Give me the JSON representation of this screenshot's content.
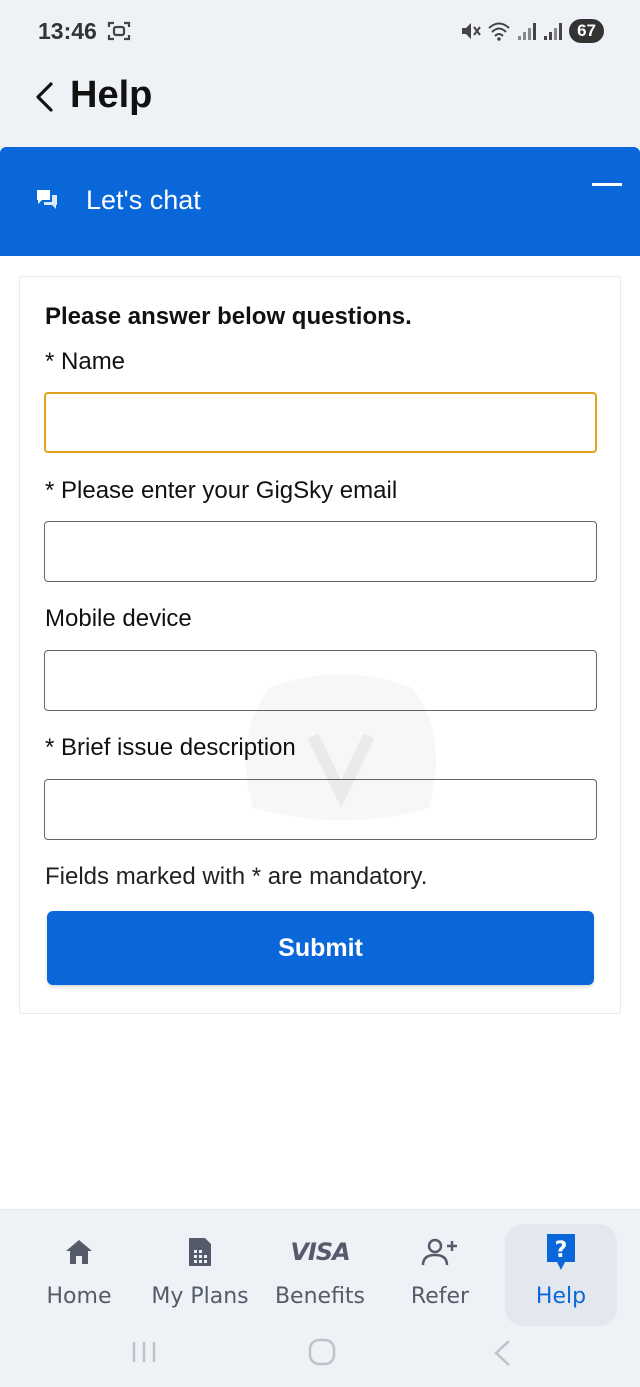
{
  "status_bar": {
    "time": "13:46",
    "battery": "67",
    "icons": [
      "screenshot-icon",
      "mute-icon",
      "wifi-icon",
      "signal-icon",
      "signal-icon"
    ]
  },
  "header": {
    "title": "Help",
    "back_icon": "chevron-left-icon"
  },
  "chat_banner": {
    "title": "Let's chat",
    "icon": "chat-bubbles-icon",
    "collapse_icon": "minus-icon"
  },
  "form": {
    "heading": "Please answer below questions.",
    "fields": [
      {
        "label": "* Name",
        "value": "",
        "focused": true
      },
      {
        "label": "* Please enter your GigSky email",
        "value": ""
      },
      {
        "label": "Mobile device",
        "value": ""
      },
      {
        "label": "* Brief issue description",
        "value": ""
      }
    ],
    "mandatory_note": "Fields marked with * are mandatory.",
    "submit_label": "Submit"
  },
  "bottom_nav": {
    "items": [
      {
        "label": "Home",
        "icon": "home-icon"
      },
      {
        "label": "My Plans",
        "icon": "sim-card-icon"
      },
      {
        "label": "Benefits",
        "icon": "visa-icon",
        "icon_text": "VISA"
      },
      {
        "label": "Refer",
        "icon": "add-person-icon"
      },
      {
        "label": "Help",
        "icon": "help-icon",
        "active": true
      }
    ]
  },
  "colors": {
    "primary": "#0a67d9",
    "focus_border": "#e2a21e",
    "nav_bg": "#eef2f6",
    "nav_label": "#555b6b"
  }
}
